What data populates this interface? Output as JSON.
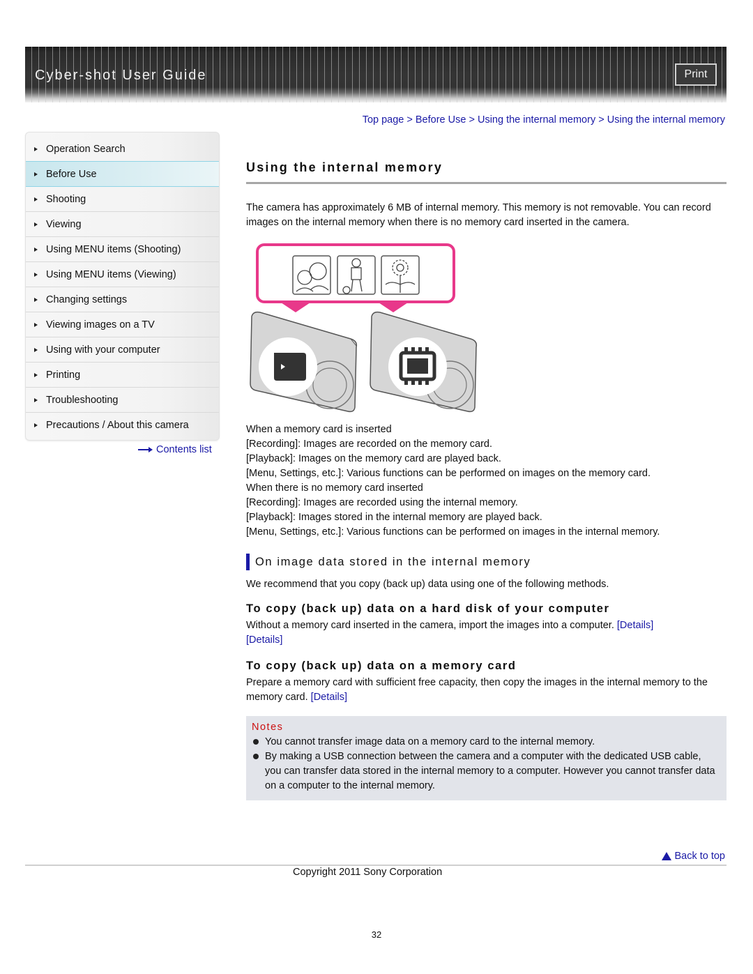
{
  "header": {
    "title": "Cyber-shot User Guide",
    "print_label": "Print"
  },
  "breadcrumb": {
    "items": [
      "Top page",
      "Before Use",
      "Using the internal memory",
      "Using the internal memory"
    ],
    "separator": ">"
  },
  "sidebar": {
    "items": [
      {
        "label": "Operation Search"
      },
      {
        "label": "Before Use",
        "active": true
      },
      {
        "label": "Shooting"
      },
      {
        "label": "Viewing"
      },
      {
        "label": "Using MENU items (Shooting)"
      },
      {
        "label": "Using MENU items (Viewing)"
      },
      {
        "label": "Changing settings"
      },
      {
        "label": "Viewing images on a TV"
      },
      {
        "label": "Using with your computer"
      },
      {
        "label": "Printing"
      },
      {
        "label": "Troubleshooting"
      },
      {
        "label": "Precautions / About this camera"
      }
    ],
    "contents_link": "Contents list"
  },
  "main": {
    "title": "Using the internal memory",
    "intro": "The camera has approximately 6 MB of internal memory. This memory is not removable. You can record images on the internal memory when there is no memory card inserted in the camera.",
    "illustration": {
      "icons": [
        "card-insert-icon",
        "internal-memory-chip-icon"
      ],
      "thumbnails": [
        "family-portrait",
        "soccer-player",
        "flower"
      ]
    },
    "lines": [
      "When a memory card is inserted",
      "[Recording]: Images are recorded on the memory card.",
      "[Playback]: Images on the memory card are played back.",
      "[Menu, Settings, etc.]: Various functions can be performed on images on the memory card.",
      "When there is no memory card inserted",
      "[Recording]: Images are recorded using the internal memory.",
      "[Playback]: Images stored in the internal memory are played back.",
      "[Menu, Settings, etc.]: Various functions can be performed on images in the internal memory."
    ],
    "section_heading": "On image data stored in the internal memory",
    "section_intro": "We recommend that you copy (back up) data using one of the following methods.",
    "sub1": {
      "heading": "To copy (back up) data on a hard disk of your computer",
      "text": "Without a memory card inserted in the camera, import the images into a computer.",
      "links": [
        "[Details]",
        "[Details]"
      ]
    },
    "sub2": {
      "heading": "To copy (back up) data on a memory card",
      "text": "Prepare a memory card with sufficient free capacity, then copy the images in the internal memory to the memory card.",
      "link": "[Details]"
    },
    "notes": {
      "title": "Notes",
      "items": [
        "You cannot transfer image data on a memory card to the internal memory.",
        "By making a USB connection between the camera and a computer with the dedicated USB cable, you can transfer data stored in the internal memory to a computer. However you cannot transfer data on a computer to the internal memory."
      ]
    }
  },
  "footer": {
    "back_to_top": "Back to top",
    "copyright": "Copyright 2011 Sony Corporation",
    "page_number": "32"
  },
  "colors": {
    "link": "#1a1aa6",
    "notes_title": "#cc1111",
    "notes_bg": "#e2e4ea",
    "accent_pink": "#e8388a",
    "active_nav": "#c9e7ee"
  }
}
